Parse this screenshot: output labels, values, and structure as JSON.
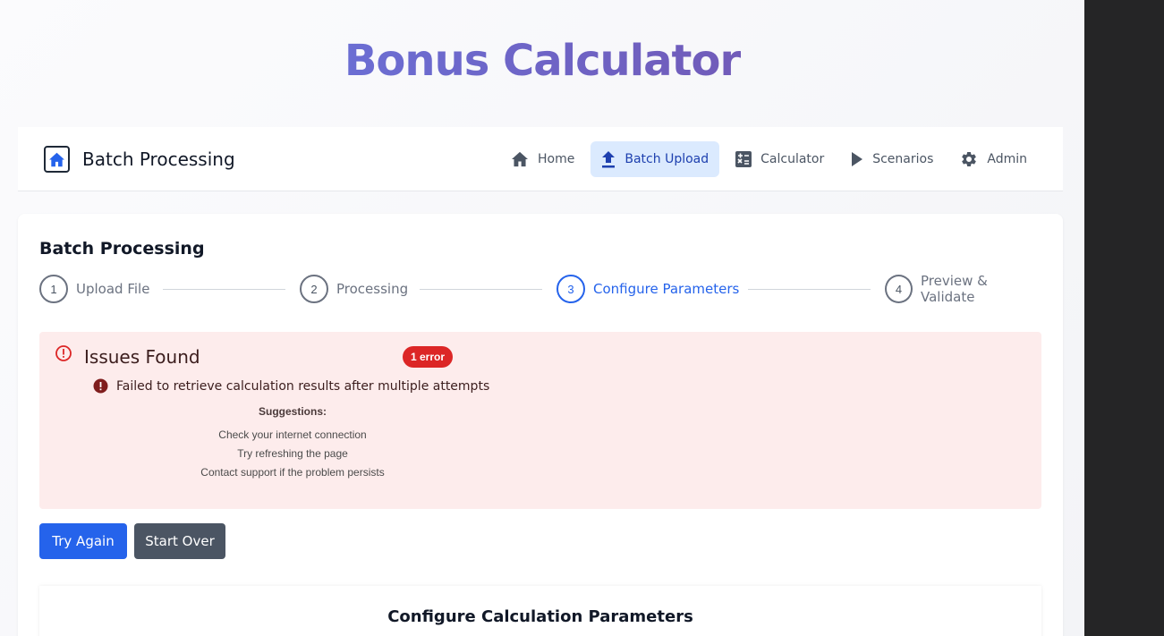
{
  "app": {
    "title": "Bonus Calculator"
  },
  "navbar": {
    "brand": "Batch Processing",
    "items": [
      {
        "label": "Home",
        "icon": "home-icon",
        "active": false
      },
      {
        "label": "Batch Upload",
        "icon": "upload-icon",
        "active": true
      },
      {
        "label": "Calculator",
        "icon": "calculator-icon",
        "active": false
      },
      {
        "label": "Scenarios",
        "icon": "play-icon",
        "active": false
      },
      {
        "label": "Admin",
        "icon": "gear-icon",
        "active": false
      }
    ]
  },
  "card": {
    "title": "Batch Processing"
  },
  "stepper": {
    "steps": [
      {
        "number": "1",
        "label": "Upload File"
      },
      {
        "number": "2",
        "label": "Processing"
      },
      {
        "number": "3",
        "label": "Configure Parameters",
        "active": true
      },
      {
        "number": "4",
        "label": "Preview & Validate"
      }
    ]
  },
  "error": {
    "title": "Issues Found",
    "badge": "1 error",
    "message": "Failed to retrieve calculation results after multiple attempts",
    "suggestions_title": "Suggestions:",
    "suggestions": [
      "Check your internet connection",
      "Try refreshing the page",
      "Contact support if the problem persists"
    ]
  },
  "actions": {
    "try_again": "Try Again",
    "start_over": "Start Over"
  },
  "parameters": {
    "title": "Configure Calculation Parameters"
  },
  "colors": {
    "accent": "#2563eb",
    "active_nav_bg": "#dbeafe",
    "error_bg": "#fdecec",
    "error_badge": "#dc2626",
    "secondary_button": "#4b5563",
    "title_gradient_start": "#667eea",
    "title_gradient_end": "#764ba2"
  }
}
